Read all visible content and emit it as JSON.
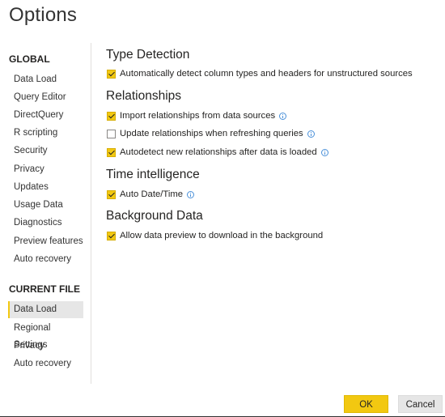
{
  "window": {
    "title": "Options"
  },
  "sidebar": {
    "global_heading": "GLOBAL",
    "global_items": [
      {
        "label": "Data Load"
      },
      {
        "label": "Query Editor"
      },
      {
        "label": "DirectQuery"
      },
      {
        "label": "R scripting"
      },
      {
        "label": "Security"
      },
      {
        "label": "Privacy"
      },
      {
        "label": "Updates"
      },
      {
        "label": "Usage Data"
      },
      {
        "label": "Diagnostics"
      },
      {
        "label": "Preview features"
      },
      {
        "label": "Auto recovery"
      }
    ],
    "current_file_heading": "CURRENT FILE",
    "current_file_items": [
      {
        "label": "Data Load",
        "selected": true
      },
      {
        "label": "Regional Settings"
      },
      {
        "label": "Privacy"
      },
      {
        "label": "Auto recovery"
      }
    ]
  },
  "main": {
    "groups": [
      {
        "title": "Type Detection",
        "options": [
          {
            "label": "Automatically detect column types and headers for unstructured sources",
            "checked": true,
            "info": false
          }
        ]
      },
      {
        "title": "Relationships",
        "options": [
          {
            "label": "Import relationships from data sources",
            "checked": true,
            "info": true
          },
          {
            "label": "Update relationships when refreshing queries",
            "checked": false,
            "info": true
          },
          {
            "label": "Autodetect new relationships after data is loaded",
            "checked": true,
            "info": true
          }
        ]
      },
      {
        "title": "Time intelligence",
        "options": [
          {
            "label": "Auto Date/Time",
            "checked": true,
            "info": true
          }
        ]
      },
      {
        "title": "Background Data",
        "options": [
          {
            "label": "Allow data preview to download in the background",
            "checked": true,
            "info": false
          }
        ]
      }
    ]
  },
  "footer": {
    "ok_label": "OK",
    "cancel_label": "Cancel"
  },
  "colors": {
    "accent": "#f2c811",
    "info": "#4a90d9",
    "selected_bg": "#e6e6e6"
  }
}
